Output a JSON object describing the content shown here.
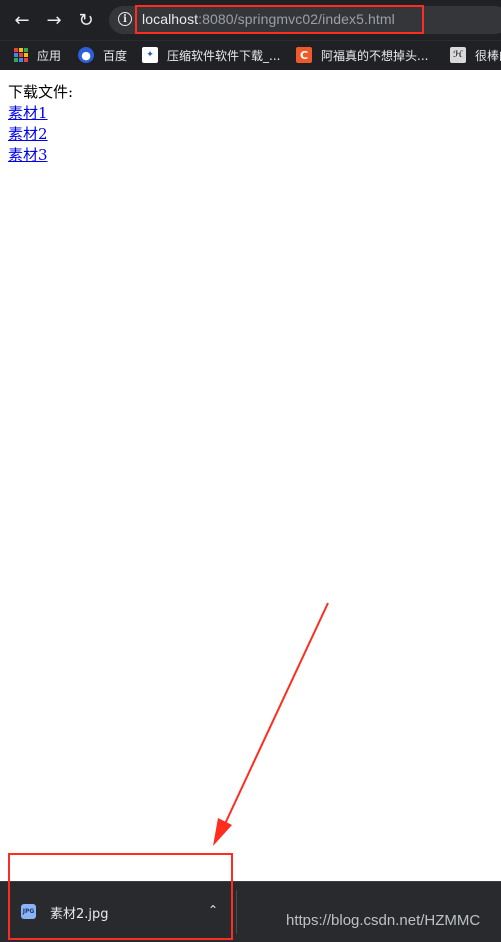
{
  "browser": {
    "back_icon": "back-arrow-icon",
    "forward_icon": "forward-arrow-icon",
    "reload_icon": "reload-icon",
    "site_info_icon": "info-icon",
    "url_host": "localhost",
    "url_rest": ":8080/springmvc02/index5.html"
  },
  "bookmarks": [
    {
      "label": "应用",
      "icon": "apps-grid-icon"
    },
    {
      "label": "百度",
      "icon": "baidu-paw-icon"
    },
    {
      "label": "压缩软件软件下载_...",
      "icon": "bookmark-site-icon"
    },
    {
      "label": "阿福真的不想掉头...",
      "icon": "csdn-c-icon"
    },
    {
      "label": "很棒的",
      "icon": "bookmark-site-icon"
    }
  ],
  "page": {
    "heading": "下载文件:",
    "links": [
      "素材1",
      "素材2",
      "素材3"
    ]
  },
  "download_bar": {
    "file_name": "素材2.jpg",
    "file_icon_text": "JPG",
    "menu_icon": "chevron-up-icon"
  },
  "watermark": "https://blog.csdn.net/HZMMC",
  "colors": {
    "toolbar_bg": "#202124",
    "annotation_red": "#ff2d1f",
    "link_blue": "#0000ee"
  }
}
